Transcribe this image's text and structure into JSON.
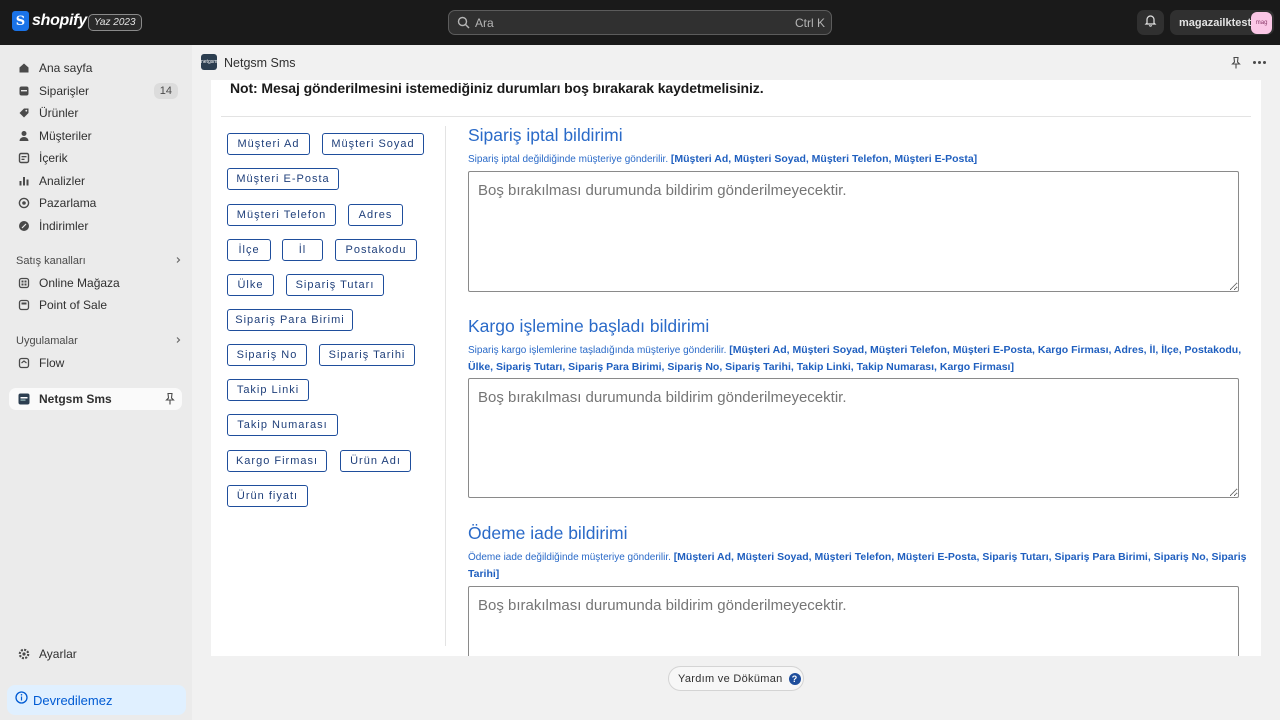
{
  "topbar": {
    "logo_text": "shopify",
    "edition": "Yaz 2023",
    "search_placeholder": "Ara",
    "search_shortcut": "Ctrl K",
    "store_name": "magazailktest",
    "avatar_text": "mag"
  },
  "sidebar": {
    "items": [
      {
        "label": "Ana sayfa",
        "icon": "home-icon"
      },
      {
        "label": "Siparişler",
        "icon": "orders-icon",
        "badge": "14"
      },
      {
        "label": "Ürünler",
        "icon": "tag-icon"
      },
      {
        "label": "Müşteriler",
        "icon": "person-icon"
      },
      {
        "label": "İçerik",
        "icon": "content-icon"
      },
      {
        "label": "Analizler",
        "icon": "chart-icon"
      },
      {
        "label": "Pazarlama",
        "icon": "target-icon"
      },
      {
        "label": "İndirimler",
        "icon": "discount-icon"
      }
    ],
    "sales_channels_heading": "Satış kanalları",
    "sales_channels": [
      {
        "label": "Online Mağaza",
        "icon": "store-icon"
      },
      {
        "label": "Point of Sale",
        "icon": "pos-icon"
      }
    ],
    "apps_heading": "Uygulamalar",
    "apps": [
      {
        "label": "Flow",
        "icon": "flow-icon"
      }
    ],
    "active_app": "Netgsm Sms",
    "settings_label": "Ayarlar",
    "devre_label": "Devredilemez"
  },
  "app_header": {
    "title": "Netgsm Sms",
    "icon_text": "netgsm"
  },
  "content": {
    "note": "Not: Mesaj gönderilmesini istemediğiniz durumları boş bırakarak kaydetmelisiniz.",
    "tags": [
      "Müşteri Ad",
      "Müşteri Soyad",
      "Müşteri E-Posta",
      "Müşteri Telefon",
      "Adres",
      "İlçe",
      "İl",
      "Postakodu",
      "Ülke",
      "Sipariş Tutarı",
      "Sipariş Para Birimi",
      "Sipariş No",
      "Sipariş Tarihi",
      "Takip Linki",
      "Takip Numarası",
      "Kargo Firması",
      "Ürün Adı",
      "Ürün fiyatı"
    ],
    "sections": [
      {
        "title": "Sipariş iptal bildirimi",
        "desc": "Sipariş iptal değildiğinde müşteriye gönderilir.",
        "vars": "[Müşteri Ad, Müşteri Soyad, Müşteri Telefon, Müşteri E-Posta]",
        "placeholder": "Boş bırakılması durumunda bildirim gönderilmeyecektir."
      },
      {
        "title": "Kargo işlemine başladı bildirimi",
        "desc": "Sipariş kargo işlemlerine taşladığında müşteriye gönderilir.",
        "vars": "[Müşteri Ad, Müşteri Soyad, Müşteri Telefon, Müşteri E-Posta, Kargo Firması, Adres, İl, İlçe, Postakodu, Ülke, Sipariş Tutarı, Sipariş Para Birimi, Sipariş No, Sipariş Tarihi, Takip Linki, Takip Numarası, Kargo Firması]",
        "placeholder": "Boş bırakılması durumunda bildirim gönderilmeyecektir."
      },
      {
        "title": "Ödeme iade bildirimi",
        "desc": "Ödeme iade değildiğinde müşteriye gönderilir.",
        "vars": "[Müşteri Ad, Müşteri Soyad, Müşteri Telefon, Müşteri E-Posta, Sipariş Tutarı, Sipariş Para Birimi, Sipariş No, Sipariş Tarihi]",
        "placeholder": "Boş bırakılması durumunda bildirim gönderilmeyecektir."
      }
    ]
  },
  "footer": {
    "help_label": "Yardım ve Döküman",
    "help_icon_text": "?"
  },
  "colors": {
    "accent": "#2a6ac8",
    "topbar": "#1a1a1a",
    "link_blue": "#005bd3"
  }
}
